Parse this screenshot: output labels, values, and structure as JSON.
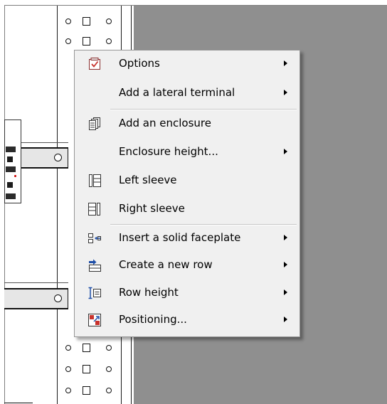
{
  "menu": {
    "items": [
      {
        "label": "Options",
        "icon": "checkbox-icon",
        "submenu": true
      },
      {
        "label": "Add a lateral terminal",
        "icon": "",
        "submenu": true
      },
      {
        "label": "Add an enclosure",
        "icon": "enclosure-stack-icon",
        "submenu": false
      },
      {
        "label": "Enclosure height...",
        "icon": "",
        "submenu": true
      },
      {
        "label": "Left sleeve",
        "icon": "left-sleeve-icon",
        "submenu": false
      },
      {
        "label": "Right sleeve",
        "icon": "right-sleeve-icon",
        "submenu": false
      },
      {
        "label": "Insert a solid faceplate",
        "icon": "faceplate-insert-icon",
        "submenu": true
      },
      {
        "label": "Create a new row",
        "icon": "new-row-icon",
        "submenu": true
      },
      {
        "label": "Row height",
        "icon": "row-height-icon",
        "submenu": true
      },
      {
        "label": "Positioning...",
        "icon": "positioning-icon",
        "submenu": true
      }
    ]
  },
  "colors": {
    "background_gray": "#8f8f8f",
    "menu_background": "#f0f0f0",
    "icon_blue": "#1f4fa8",
    "icon_red": "#c8322d"
  }
}
